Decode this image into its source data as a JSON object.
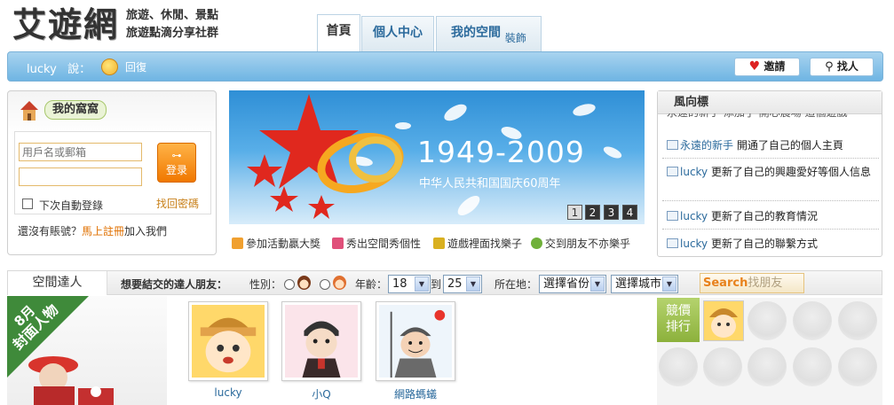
{
  "site": {
    "logo": "艾遊網",
    "slogan_line1": "旅遊、休閒、景點",
    "slogan_line2": "旅遊點滴分享社群"
  },
  "tabs": [
    {
      "label": "首頁",
      "active": true
    },
    {
      "label": "個人中心",
      "active": false
    },
    {
      "label": "我的空間",
      "suffix": "裝飾",
      "active": false
    }
  ],
  "navbar": {
    "username": "lucky",
    "says": "說：",
    "reply": "回復",
    "invite": "邀請",
    "find_people": "找人"
  },
  "login": {
    "title": "我的窩窩",
    "username_placeholder": "用戶名或郵箱",
    "login_button": "登录",
    "auto_login": "下次自動登錄",
    "forgot_password": "找回密碼",
    "no_account": "還沒有賬號？",
    "register": "馬上註冊",
    "join": "加入我們"
  },
  "banner": {
    "years": "1949-2009",
    "caption": "中华人民共和国国庆60周年",
    "pages": [
      "1",
      "2",
      "3",
      "4"
    ],
    "current_page": 1
  },
  "features": [
    {
      "label": "參加活動贏大獎",
      "color": "#f0a030"
    },
    {
      "label": "秀出空間秀個性",
      "color": "#e0507a"
    },
    {
      "label": "遊戲裡面找樂子",
      "color": "#d9b020"
    },
    {
      "label": "交到朋友不亦樂乎",
      "color": "#6fb03a"
    }
  ],
  "feed": {
    "title": "風向標",
    "partial_top": "永遠的新手 添加了 開心農場 這個遊戲",
    "items": [
      {
        "user": "永遠的新手",
        "action": "開通了自己的個人主頁"
      },
      {
        "user": "lucky",
        "action": "更新了自己的興趣愛好等個人信息"
      },
      {
        "user": "lucky",
        "action": "更新了自己的教育情況"
      },
      {
        "user": "lucky",
        "action": "更新了自己的聯繫方式"
      }
    ]
  },
  "talent": {
    "tab": "空間達人",
    "prompt": "想要結交的達人朋友：",
    "gender_label": "性別：",
    "age_label": "年齡：",
    "age_from": "18",
    "to": "到",
    "age_to": "25",
    "location_label": "所在地：",
    "province": "選擇省份",
    "city": "選擇城市",
    "search_word": "Search",
    "search_suffix": "找朋友"
  },
  "cover": {
    "month": "8月",
    "title": "封面人物"
  },
  "people": [
    {
      "name": "lucky"
    },
    {
      "name": "小Q"
    },
    {
      "name": "網路螞蟻"
    }
  ],
  "ranking": {
    "label_line1": "競價",
    "label_line2": "排行"
  }
}
